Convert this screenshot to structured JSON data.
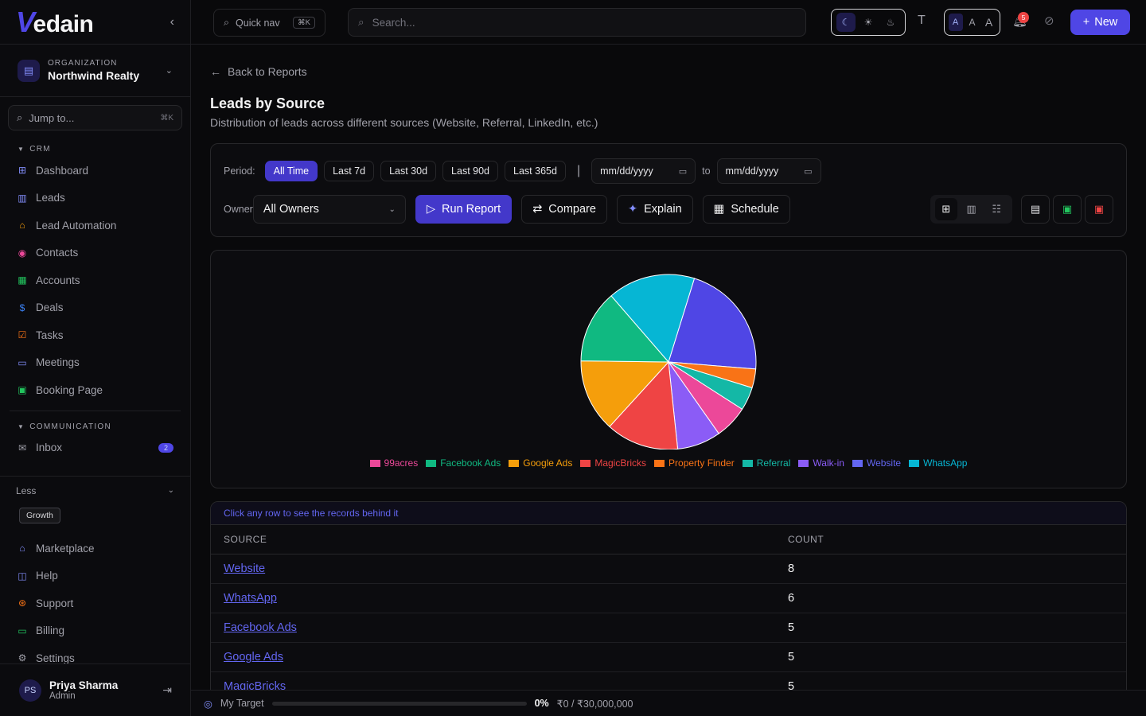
{
  "brand": {
    "logo_mark": "V",
    "logo_text": "edain"
  },
  "org": {
    "label": "ORGANIZATION",
    "name": "Northwind Realty"
  },
  "jump": {
    "placeholder": "Jump to...",
    "shortcut": "⌘K"
  },
  "sections": {
    "crm": {
      "title": "CRM",
      "items": [
        {
          "label": "Dashboard",
          "icon": "dashboard-icon",
          "color": "#818cf8"
        },
        {
          "label": "Leads",
          "icon": "leads-icon",
          "color": "#818cf8"
        },
        {
          "label": "Lead Automation",
          "icon": "bot-icon",
          "color": "#f59e0b"
        },
        {
          "label": "Contacts",
          "icon": "contacts-icon",
          "color": "#ec4899"
        },
        {
          "label": "Accounts",
          "icon": "building-icon",
          "color": "#22c55e"
        },
        {
          "label": "Deals",
          "icon": "dollar-icon",
          "color": "#3b82f6"
        },
        {
          "label": "Tasks",
          "icon": "checklist-icon",
          "color": "#f97316"
        },
        {
          "label": "Meetings",
          "icon": "calendar-icon",
          "color": "#818cf8"
        },
        {
          "label": "Booking Page",
          "icon": "calendar-check-icon",
          "color": "#22c55e"
        }
      ]
    },
    "communication": {
      "title": "COMMUNICATION",
      "items": [
        {
          "label": "Inbox",
          "icon": "mail-icon",
          "badge": "2",
          "color": "#a1a1aa"
        }
      ]
    }
  },
  "less": {
    "label": "Less",
    "tag": "Growth"
  },
  "bottom_nav": [
    {
      "label": "Marketplace",
      "icon": "store-icon",
      "color": "#818cf8"
    },
    {
      "label": "Help",
      "icon": "book-icon",
      "color": "#818cf8"
    },
    {
      "label": "Support",
      "icon": "lifebuoy-icon",
      "color": "#f97316"
    },
    {
      "label": "Billing",
      "icon": "card-icon",
      "color": "#22c55e"
    },
    {
      "label": "Settings",
      "icon": "gear-icon",
      "color": "#a1a1aa"
    }
  ],
  "user": {
    "initials": "PS",
    "name": "Priya Sharma",
    "role": "Admin"
  },
  "topbar": {
    "quicknav": "Quick nav",
    "quicknav_kbd": "⌘K",
    "search_placeholder": "Search...",
    "font_sizes": [
      "A",
      "A",
      "A"
    ],
    "notifications": "5",
    "new_label": "New"
  },
  "page": {
    "back": "Back to Reports",
    "title": "Leads by Source",
    "subtitle": "Distribution of leads across different sources (Website, Referral, LinkedIn, etc.)"
  },
  "filters": {
    "period_label": "Period:",
    "periods": [
      "All Time",
      "Last 7d",
      "Last 30d",
      "Last 90d",
      "Last 365d"
    ],
    "active_period": "All Time",
    "separator": "|",
    "date_from": "mm/dd/yyyy",
    "date_to": "mm/dd/yyyy",
    "to_label": "to",
    "owner_label": "Owner",
    "owner_value": "All Owners",
    "run": "Run Report",
    "compare": "Compare",
    "explain": "Explain",
    "schedule": "Schedule"
  },
  "chart_data": {
    "type": "pie",
    "slices": [
      {
        "label": "Website",
        "value": 8,
        "color": "#4f46e5"
      },
      {
        "label": "Property Finder",
        "value": 1.3,
        "color": "#f97316"
      },
      {
        "label": "Referral",
        "value": 1.6,
        "color": "#14b8a6"
      },
      {
        "label": "99acres",
        "value": 2.3,
        "color": "#ec4899"
      },
      {
        "label": "Walk-in",
        "value": 3,
        "color": "#8b5cf6"
      },
      {
        "label": "MagicBricks",
        "value": 5,
        "color": "#ef4444"
      },
      {
        "label": "Google Ads",
        "value": 5,
        "color": "#f59e0b"
      },
      {
        "label": "Facebook Ads",
        "value": 5,
        "color": "#10b981"
      },
      {
        "label": "WhatsApp",
        "value": 6,
        "color": "#06b6d4"
      }
    ],
    "legend": [
      {
        "label": "99acres",
        "color": "#ec4899"
      },
      {
        "label": "Facebook Ads",
        "color": "#10b981"
      },
      {
        "label": "Google Ads",
        "color": "#f59e0b"
      },
      {
        "label": "MagicBricks",
        "color": "#ef4444"
      },
      {
        "label": "Property Finder",
        "color": "#f97316"
      },
      {
        "label": "Referral",
        "color": "#14b8a6"
      },
      {
        "label": "Walk-in",
        "color": "#8b5cf6"
      },
      {
        "label": "Website",
        "color": "#6366f1"
      },
      {
        "label": "WhatsApp",
        "color": "#06b6d4"
      }
    ],
    "legend_position": "bottom"
  },
  "table": {
    "hint": "Click any row to see the records behind it",
    "columns": [
      "SOURCE",
      "COUNT"
    ],
    "rows": [
      {
        "source": "Website",
        "count": "8"
      },
      {
        "source": "WhatsApp",
        "count": "6"
      },
      {
        "source": "Facebook Ads",
        "count": "5"
      },
      {
        "source": "Google Ads",
        "count": "5"
      },
      {
        "source": "MagicBricks",
        "count": "5"
      }
    ]
  },
  "footer": {
    "label": "My Target",
    "progress": 0,
    "pct": "0%",
    "amount": "₹0 / ₹30,000,000"
  }
}
